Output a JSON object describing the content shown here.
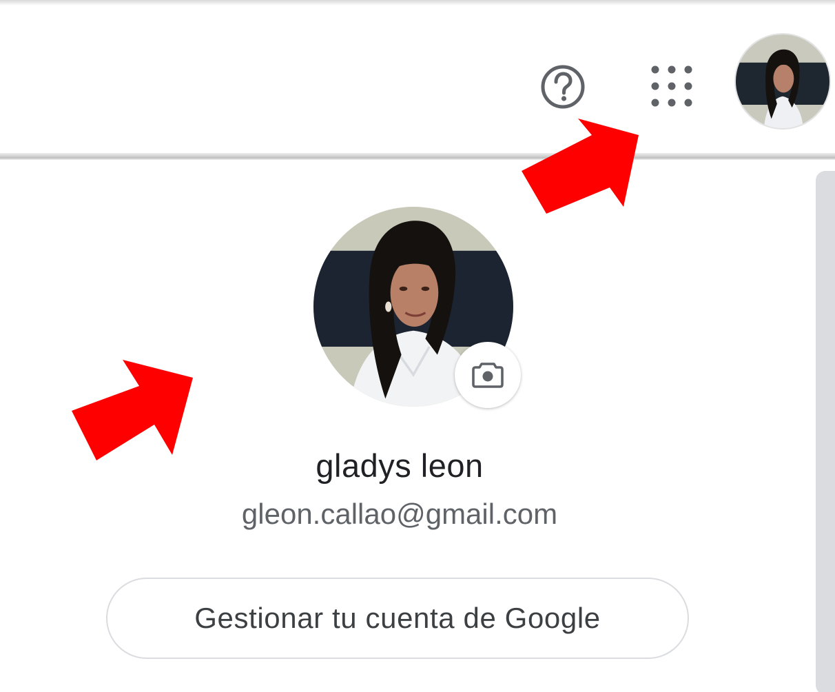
{
  "header": {
    "icons": [
      "help-icon",
      "apps-grid-icon",
      "account-avatar-icon"
    ]
  },
  "account_panel": {
    "name": "gladys leon",
    "email": "gleon.callao@gmail.com",
    "manage_button_label": "Gestionar tu cuenta de Google",
    "change_photo_icon": "camera-icon"
  },
  "annotations": {
    "arrow_color": "#ff0000",
    "arrow_count": 2
  },
  "colors": {
    "name_text": "#202124",
    "email_text": "#5f6368",
    "button_text": "#3c4043",
    "border": "#dadce0",
    "icon": "#5f6368"
  }
}
